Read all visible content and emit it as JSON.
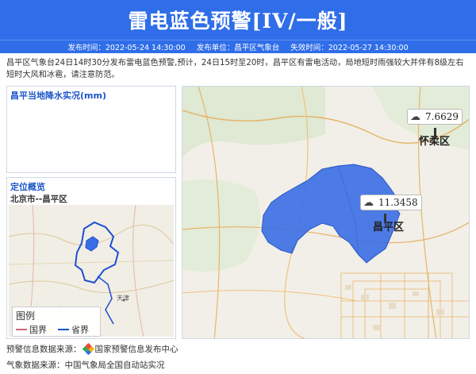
{
  "header": {
    "title": "雷电蓝色预警[IV/一般]",
    "issue_time": "发布时间：2022-05-24 14:30:00",
    "issuer": "发布单位：昌平区气象台",
    "expire_time": "失效时间：2022-05-27 14:30:00"
  },
  "description": "昌平区气象台24日14时30分发布雷电蓝色预警,预计，24日15时至20时，昌平区有雷电活动，局地短时雨强较大并伴有8级左右短时大风和冰雹，请注意防范。",
  "rain_panel": {
    "title": "昌平当地降水实况(mm)"
  },
  "location_panel": {
    "title": "定位概览",
    "subtitle": "北京市--昌平区",
    "minimap_place": "天津"
  },
  "legend": {
    "title": "图例",
    "items": [
      {
        "label": "国界",
        "color": "#c9687a"
      },
      {
        "label": "省界",
        "color": "#1f4fd1"
      }
    ]
  },
  "map": {
    "stations": [
      {
        "value": "7.6629",
        "district": "怀柔区",
        "icon": "thunder-cloud-icon"
      },
      {
        "value": "11.3458",
        "district": "昌平区",
        "icon": "thunder-cloud-icon"
      }
    ],
    "highlight_color": "#3a6ee6"
  },
  "footer": {
    "warning_source": "预警信息数据来源：",
    "warning_source_name": "国家预警信息发布中心",
    "weather_source": "气象数据来源：中国气象局全国自动站实况"
  }
}
